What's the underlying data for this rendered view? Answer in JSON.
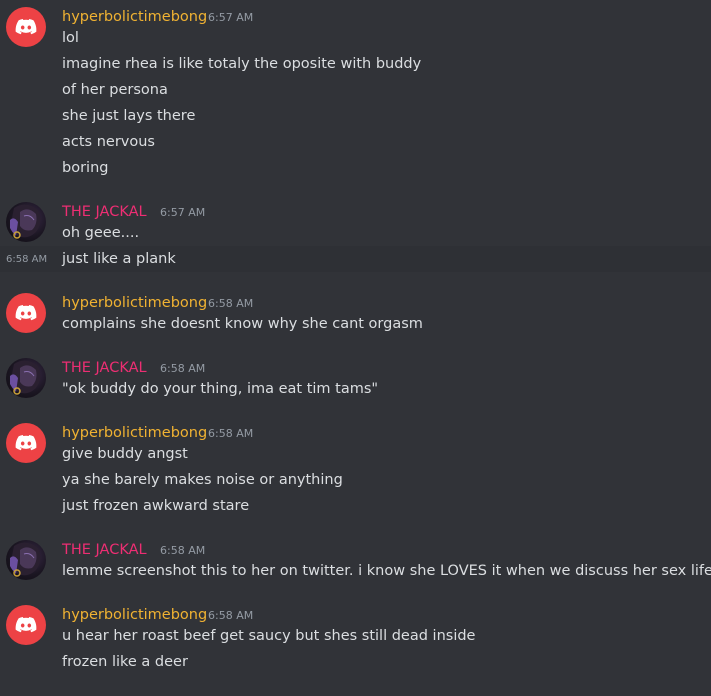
{
  "colors": {
    "background": "#313338",
    "text": "#dbdee1",
    "timestamp": "#949ba4",
    "hyperbolic_name": "#f0b232",
    "jackal_name": "#ed2e73",
    "discord_avatar": "#ed4245",
    "hover_row": "#2e3035"
  },
  "messages": [
    {
      "author": "hyperbolictimebong",
      "time": "6:57 AM",
      "avatar": "discord-logo-icon",
      "lines": [
        "lol",
        "imagine rhea is like totaly the oposite with buddy",
        "of her persona",
        "she just lays there",
        "acts nervous",
        "boring"
      ]
    },
    {
      "author": "THE JACKAL",
      "time": "6:57 AM",
      "avatar": "user-avatar-image",
      "lines": [
        "oh geee....",
        "just like a plank"
      ],
      "hover_time": "6:58 AM"
    },
    {
      "author": "hyperbolictimebong",
      "time": "6:58 AM",
      "avatar": "discord-logo-icon",
      "lines": [
        "complains she doesnt know why she cant orgasm"
      ]
    },
    {
      "author": "THE JACKAL",
      "time": "6:58 AM",
      "avatar": "user-avatar-image",
      "lines": [
        "\"ok buddy do your thing, ima eat tim tams\""
      ]
    },
    {
      "author": "hyperbolictimebong",
      "time": "6:58 AM",
      "avatar": "discord-logo-icon",
      "lines": [
        "give buddy angst",
        "ya she barely makes noise or anything",
        "just frozen awkward stare"
      ]
    },
    {
      "author": "THE JACKAL",
      "time": "6:58 AM",
      "avatar": "user-avatar-image",
      "lines": [
        "lemme screenshot this to her on twitter. i know she LOVES it when we discuss her sex life"
      ]
    },
    {
      "author": "hyperbolictimebong",
      "time": "6:58 AM",
      "avatar": "discord-logo-icon",
      "lines": [
        "u hear her roast beef get saucy but shes still dead inside",
        "frozen like a deer"
      ]
    }
  ]
}
